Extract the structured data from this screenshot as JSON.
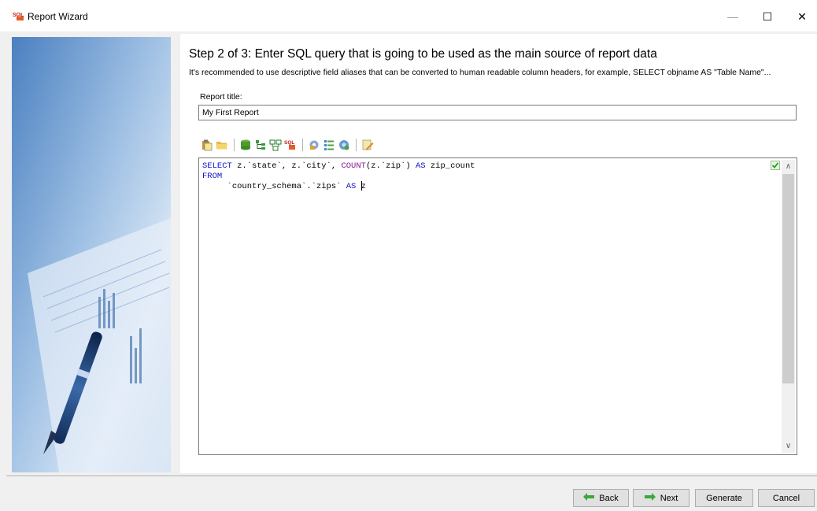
{
  "window": {
    "title": "Report Wizard",
    "app_icon": "sql-app-icon",
    "controls": {
      "minimize": "—",
      "maximize": "☐",
      "close": "✕"
    }
  },
  "step": {
    "title": "Step 2 of 3:  Enter SQL query that is going to be used as the main source of report data",
    "description": "It's recommended to use descriptive field aliases that can be converted to human readable column headers, for example, SELECT objname AS \"Table Name\"..."
  },
  "report_title": {
    "label": "Report title:",
    "value": "My First Report"
  },
  "toolbar": {
    "icons": [
      "paste-icon",
      "open-folder-icon",
      "database-icon",
      "tree-icon",
      "query-builder-icon",
      "sql-icon",
      "settings-icon",
      "list-icon",
      "gear-icon",
      "edit-icon"
    ]
  },
  "sql": {
    "line1": {
      "kw_select": "SELECT",
      "part1": " z.`state`, z.`city`, ",
      "fn_count": "COUNT",
      "part2": "(z.`zip`) ",
      "kw_as": "AS",
      "part3": " zip_count"
    },
    "line2": {
      "kw_from": "FROM"
    },
    "line3": {
      "indent": "     ",
      "part1": "`country_schema`.`zips` ",
      "kw_as": "AS",
      "part2": " ",
      "alias": "z"
    },
    "validation_icon": "check-icon"
  },
  "buttons": {
    "back": "Back",
    "next": "Next",
    "generate": "Generate",
    "cancel": "Cancel"
  },
  "colors": {
    "keyword": "#1010c8",
    "function": "#8a1a8a",
    "arrow_green": "#3aa83a"
  }
}
